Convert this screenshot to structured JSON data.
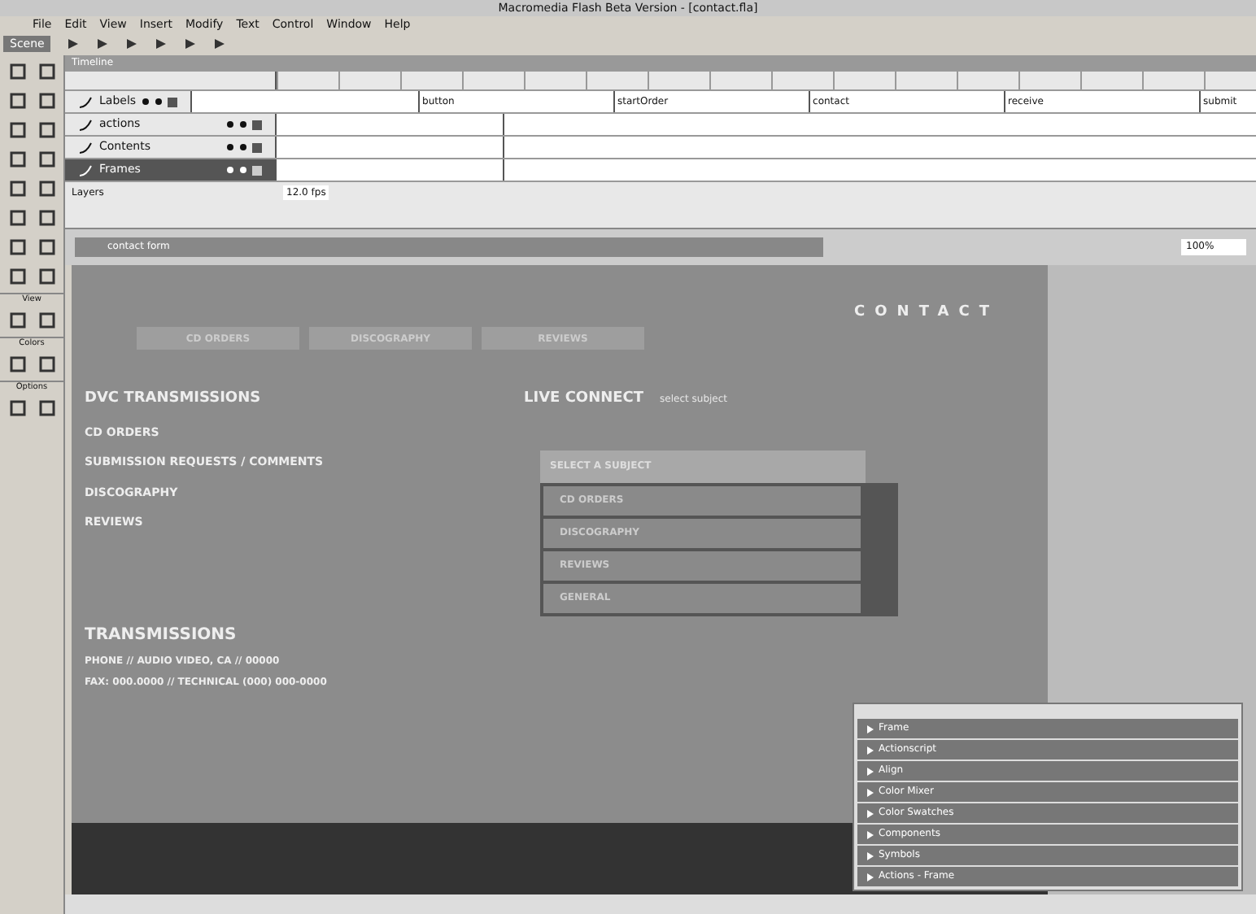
{
  "window": {
    "title": "Macromedia Flash Beta Version - [contact.fla]"
  },
  "menu": [
    "File",
    "Edit",
    "View",
    "Insert",
    "Modify",
    "Text",
    "Control",
    "Window",
    "Help"
  ],
  "scene_button": "Scene",
  "timeline": {
    "title": "Timeline",
    "fps": "12.0 fps",
    "layers": [
      {
        "name": "Labels",
        "visible": true,
        "locked": true,
        "selected": false,
        "labels": [
          "button",
          "startOrder",
          "contact",
          "receive",
          "submit"
        ]
      },
      {
        "name": "actions",
        "visible": true,
        "locked": true,
        "selected": false
      },
      {
        "name": "Contents",
        "visible": true,
        "locked": true,
        "selected": false
      },
      {
        "name": "Frames",
        "visible": true,
        "locked": true,
        "selected": true
      }
    ],
    "footer_label": "Layers"
  },
  "edit_bar": {
    "scene": "contact form",
    "zoom": "100%"
  },
  "toolbox": {
    "sections": [
      "View",
      "Colors",
      "Options"
    ]
  },
  "stage": {
    "header": "CONTACT",
    "nav": [
      "CD ORDERS",
      "DISCOGRAPHY",
      "REVIEWS"
    ],
    "left_heading": "DVC TRANSMISSIONS",
    "links": [
      "CD ORDERS",
      "SUBMISSION REQUESTS / COMMENTS",
      "DISCOGRAPHY",
      "REVIEWS"
    ],
    "right_heading": "LIVE CONNECT",
    "right_sub": "select subject",
    "dropdown": {
      "value": "SELECT A SUBJECT",
      "options": [
        "CD ORDERS",
        "DISCOGRAPHY",
        "REVIEWS",
        "GENERAL"
      ]
    },
    "bottom_heading": "TRANSMISSIONS",
    "address": [
      "PHONE // AUDIO VIDEO, CA // 00000",
      "FAX: 000.0000 // TECHNICAL (000) 000-0000"
    ]
  },
  "panels": [
    "Frame",
    "Actionscript",
    "Align",
    "Color Mixer",
    "Color Swatches",
    "Components",
    "Symbols",
    "Actions - Frame"
  ]
}
